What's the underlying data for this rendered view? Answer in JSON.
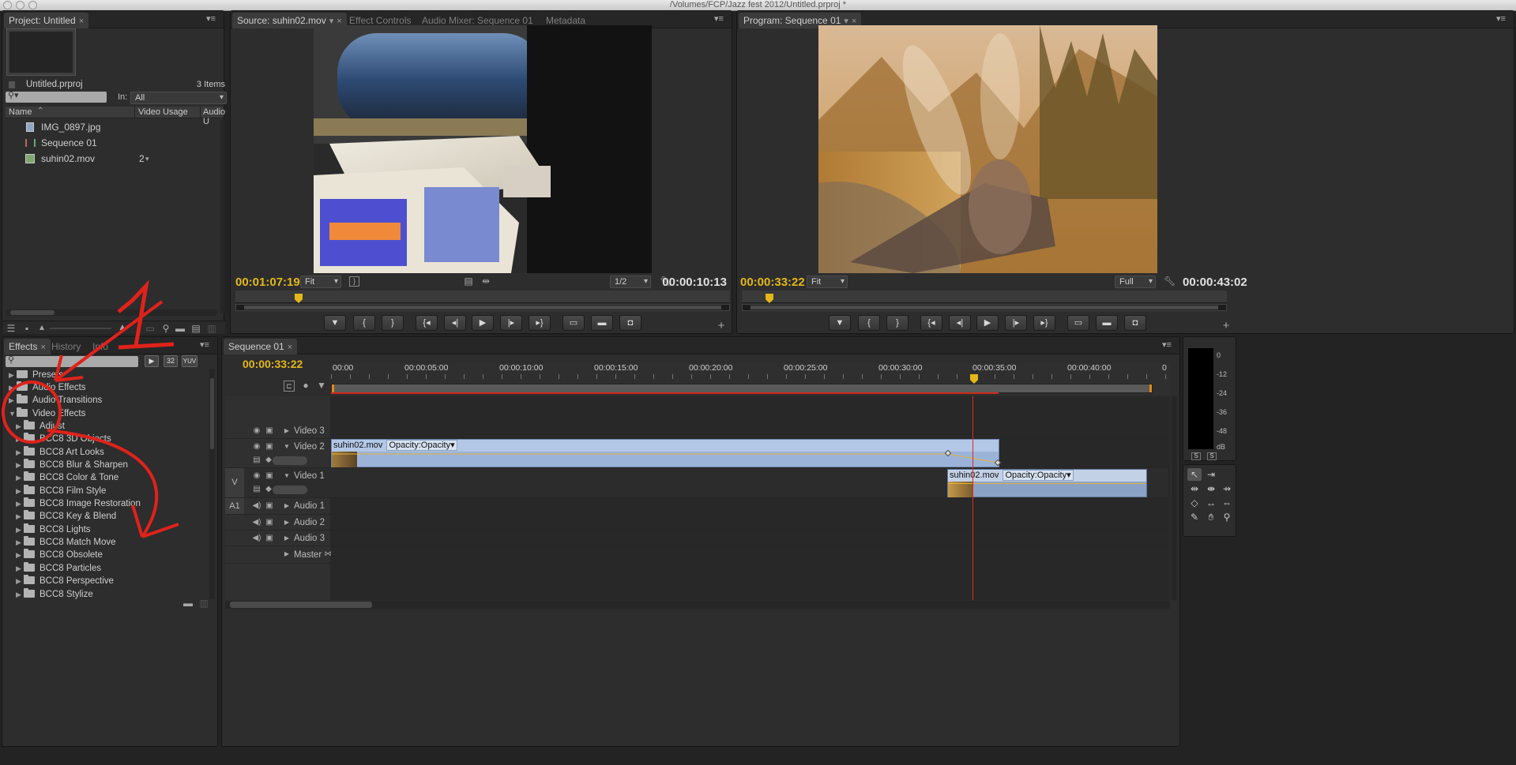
{
  "window": {
    "title": "/Volumes/FCP/Jazz fest 2012/Untitled.prproj *"
  },
  "project": {
    "tab": "Project: Untitled",
    "file": "Untitled.prproj",
    "items_count": "3 Items",
    "search_placeholder": "",
    "in_label": "In:",
    "in_value": "All",
    "columns": [
      "Name",
      "Video Usage",
      "Audio U"
    ],
    "items": [
      {
        "name": "IMG_0897.jpg",
        "usage": "",
        "icon": "image-icon"
      },
      {
        "name": "Sequence 01",
        "usage": "",
        "icon": "sequence-icon"
      },
      {
        "name": "suhin02.mov",
        "usage": "2",
        "icon": "movie-icon"
      }
    ]
  },
  "source": {
    "tabs": [
      "Source: suhin02.mov",
      "Effect Controls",
      "Audio Mixer: Sequence 01",
      "Metadata"
    ],
    "timecode": "00:01:07:19",
    "fit": "Fit",
    "resolution": "1/2",
    "duration": "00:00:10:13"
  },
  "program": {
    "tab": "Program: Sequence 01",
    "timecode": "00:00:33:22",
    "fit": "Fit",
    "resolution": "Full",
    "duration": "00:00:43:02"
  },
  "effects": {
    "tabs": [
      "Effects",
      "History",
      "Info"
    ],
    "badges": [
      "32",
      "YUV"
    ],
    "items": [
      {
        "label": "Presets",
        "level": 0,
        "expanded": false
      },
      {
        "label": "Audio Effects",
        "level": 0,
        "expanded": false
      },
      {
        "label": "Audio Transitions",
        "level": 0,
        "expanded": false
      },
      {
        "label": "Video Effects",
        "level": 0,
        "expanded": true
      },
      {
        "label": "Adjust",
        "level": 1,
        "expanded": false
      },
      {
        "label": "BCC8 3D Objects",
        "level": 1,
        "expanded": false
      },
      {
        "label": "BCC8 Art Looks",
        "level": 1,
        "expanded": false
      },
      {
        "label": "BCC8 Blur & Sharpen",
        "level": 1,
        "expanded": false
      },
      {
        "label": "BCC8 Color & Tone",
        "level": 1,
        "expanded": false
      },
      {
        "label": "BCC8 Film Style",
        "level": 1,
        "expanded": false
      },
      {
        "label": "BCC8 Image Restoration",
        "level": 1,
        "expanded": false
      },
      {
        "label": "BCC8 Key & Blend",
        "level": 1,
        "expanded": false
      },
      {
        "label": "BCC8 Lights",
        "level": 1,
        "expanded": false
      },
      {
        "label": "BCC8 Match Move",
        "level": 1,
        "expanded": false
      },
      {
        "label": "BCC8 Obsolete",
        "level": 1,
        "expanded": false
      },
      {
        "label": "BCC8 Particles",
        "level": 1,
        "expanded": false
      },
      {
        "label": "BCC8 Perspective",
        "level": 1,
        "expanded": false
      },
      {
        "label": "BCC8 Stylize",
        "level": 1,
        "expanded": false
      }
    ]
  },
  "timeline": {
    "tab": "Sequence 01",
    "timecode": "00:00:33:22",
    "ruler": [
      "00:00",
      "00:00:05:00",
      "00:00:10:00",
      "00:00:15:00",
      "00:00:20:00",
      "00:00:25:00",
      "00:00:30:00",
      "00:00:35:00",
      "00:00:40:00",
      "0"
    ],
    "tracks": {
      "video3": "Video 3",
      "video2": "Video 2",
      "video1": "Video 1",
      "audio1": "Audio 1",
      "audio2": "Audio 2",
      "audio3": "Audio 3",
      "master": "Master"
    },
    "v_label": "V",
    "a_label": "A1",
    "clip1": {
      "name": "suhin02.mov",
      "effect": "Opacity:Opacity"
    },
    "clip2": {
      "name": "suhin02.mov",
      "effect": "Opacity:Opacity"
    }
  },
  "audio_meter": {
    "labels": [
      "0",
      "-12",
      "-24",
      "-36",
      "-48",
      "dB"
    ],
    "solo": [
      "S",
      "S"
    ]
  },
  "annotation": {
    "number": "1",
    "color": "#e0221b"
  },
  "colors": {
    "timecode": "#e4b818",
    "playhead": "#e02b1c",
    "clip": "#9bb3d8"
  }
}
